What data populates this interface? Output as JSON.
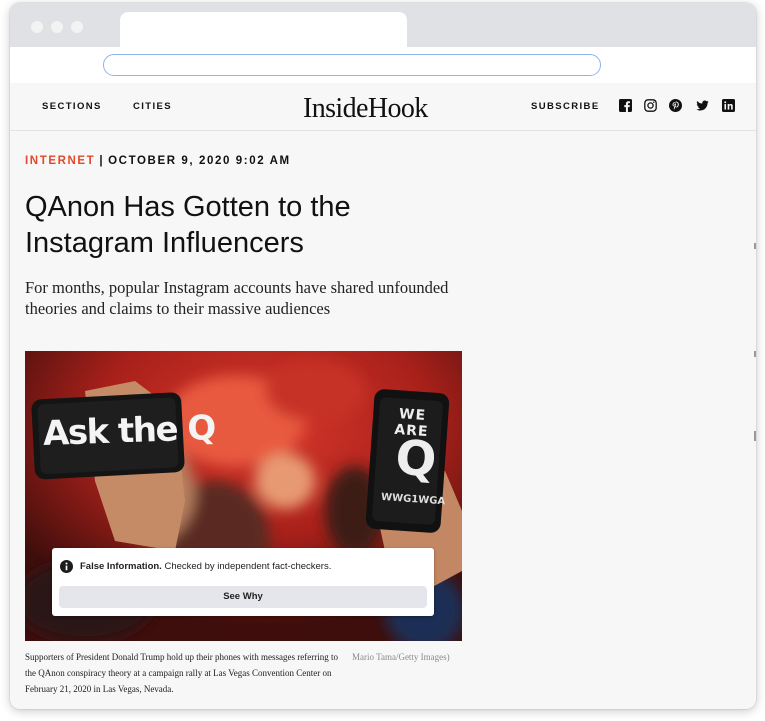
{
  "site": {
    "nav": {
      "sections": "SECTIONS",
      "cities": "CITIES",
      "subscribe": "SUBSCRIBE"
    },
    "logo": "InsideHook",
    "social_icons": [
      "facebook-icon",
      "instagram-icon",
      "pinterest-icon",
      "twitter-icon",
      "linkedin-icon"
    ]
  },
  "article": {
    "category": "INTERNET",
    "separator": "|",
    "datetime": "OCTOBER 9, 2020 9:02 AM",
    "headline": "QAnon Has Gotten to the Instagram Influencers",
    "dek": "For months, popular Instagram accounts have shared unfounded theories and claims to their massive audiences",
    "image": {
      "sign_left": "Ask the Q",
      "sign_right_top": "WE ARE",
      "sign_right_big": "Q",
      "sign_right_bottom": "WWG1WGA",
      "fact_check": {
        "label": "False Information.",
        "text": "Checked by independent fact-checkers.",
        "button": "See Why"
      }
    },
    "caption": "Supporters of President Donald Trump hold up their phones with messages referring to the QAnon conspiracy theory at a campaign rally at Las Vegas Convention Center on February 21, 2020 in Las Vegas, Nevada.",
    "credit": "Mario Tama/Getty Images)"
  },
  "colors": {
    "accent": "#e0492a",
    "text": "#111111",
    "background": "#f7f7f7"
  }
}
